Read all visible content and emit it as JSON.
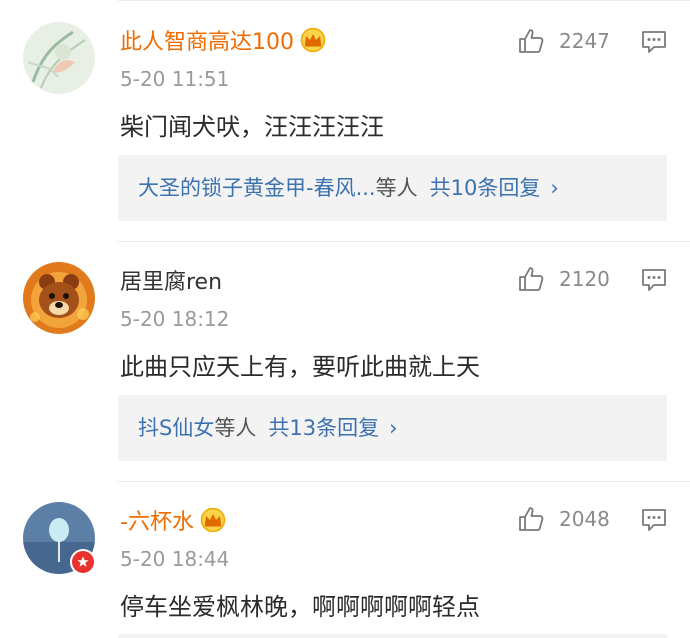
{
  "comments": [
    {
      "username": "此人智商高达100",
      "is_vip": true,
      "time": "5-20 11:51",
      "text": "柴门闻犬吠，汪汪汪汪汪",
      "likes": "2247",
      "reply": {
        "users": "大圣的锁子黄金甲-春风...",
        "suffix": "等人",
        "count": "共10条回复"
      }
    },
    {
      "username": "居里腐ren",
      "is_vip": false,
      "time": "5-20 18:12",
      "text": "此曲只应天上有，要听此曲就上天",
      "likes": "2120",
      "reply": {
        "users": "抖S仙女",
        "suffix": "等人",
        "count": "共13条回复"
      }
    },
    {
      "username": "-六杯水",
      "is_vip": true,
      "time": "5-20 18:44",
      "text": "停车坐爱枫林晚，啊啊啊啊啊轻点",
      "likes": "2048"
    }
  ],
  "icons": {
    "like": "thumbs-up-icon",
    "reply": "comment-bubble-icon",
    "vip": "crown-icon",
    "chevron": "chevron-right-icon"
  },
  "colors": {
    "vip_name": "#f06c00",
    "link_blue": "#3d72b0",
    "muted": "#9a9a9a",
    "reply_bg": "#f3f3f3"
  }
}
